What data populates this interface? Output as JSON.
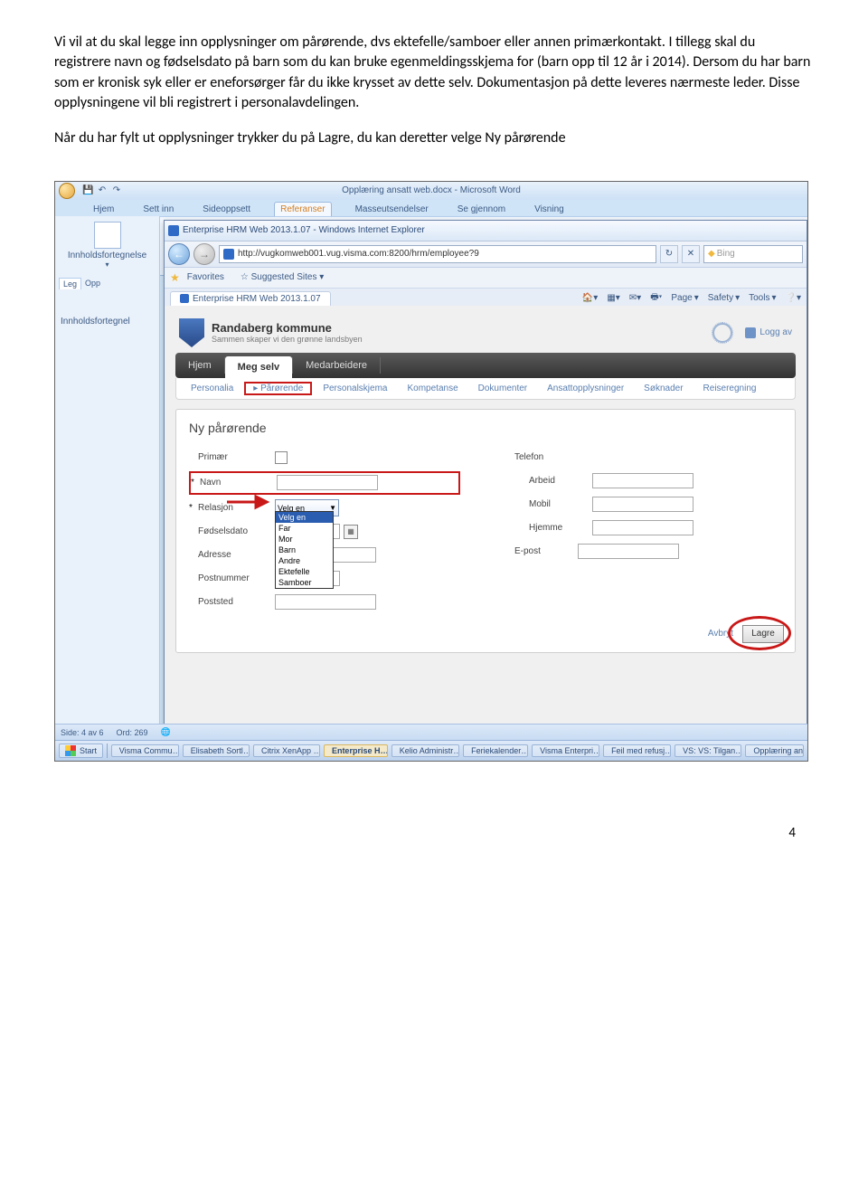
{
  "doc": {
    "p1": "Vi vil at du skal legge inn opplysninger om pårørende, dvs ektefelle/samboer eller annen primærkontakt. I tillegg skal du registrere navn og fødselsdato på barn som du kan bruke egenmeldingsskjema for (barn opp til 12 år i 2014). Dersom du har barn som er kronisk syk eller er eneforsørger får du ikke krysset av dette selv. Dokumentasjon på dette leveres nærmeste leder. Disse opplysningene vil bli registrert i personalavdelingen.",
    "p2": "Når du har fylt ut opplysninger trykker du på Lagre, du kan deretter velge Ny pårørende"
  },
  "word": {
    "title": "Opplæring ansatt web.docx - Microsoft Word",
    "tabs": [
      "Hjem",
      "Sett inn",
      "Sideoppsett",
      "Referanser",
      "Masseutsendelser",
      "Se gjennom",
      "Visning"
    ],
    "active_tab_idx": 3,
    "left_tabs": [
      "Leg",
      "Opp"
    ],
    "toc_label": "Innholdsfortegnelse",
    "toc_btn": "Innholdsfortegnel",
    "status_side": "Side: 4 av 6",
    "status_ord": "Ord: 269"
  },
  "ie": {
    "title": "Enterprise HRM Web 2013.1.07 - Windows Internet Explorer",
    "url": "http://vugkomweb001.vug.visma.com:8200/hrm/employee?9",
    "search_placeholder": "Bing",
    "fav_label": "Favorites",
    "suggested": "Suggested Sites",
    "tab_title": "Enterprise HRM Web 2013.1.07",
    "tools": [
      "Page",
      "Safety",
      "Tools"
    ]
  },
  "hrm": {
    "brand": "Randaberg kommune",
    "slogan": "Sammen skaper vi den grønne landsbyen",
    "logoff": "Logg av",
    "nav": [
      "Hjem",
      "Meg selv",
      "Medarbeidere"
    ],
    "nav_active_idx": 1,
    "subnav": [
      "Personalia",
      "Pårørende",
      "Personalskjema",
      "Kompetanse",
      "Dokumenter",
      "Ansattopplysninger",
      "Søknader",
      "Reiseregning"
    ],
    "subnav_hl_idx": 1,
    "form": {
      "title": "Ny pårørende",
      "left_labels": [
        "Primær",
        "Navn",
        "Relasjon",
        "Fødselsdato",
        "Adresse",
        "Postnummer",
        "Poststed"
      ],
      "right_labels": [
        "Telefon",
        "Arbeid",
        "Mobil",
        "Hjemme",
        "E-post"
      ],
      "select_value": "Velg en",
      "select_options": [
        "Velg en",
        "Far",
        "Mor",
        "Barn",
        "Andre",
        "Ektefelle",
        "Samboer"
      ],
      "avbryt": "Avbryt",
      "lagre": "Lagre"
    }
  },
  "taskbar": {
    "start": "Start",
    "items": [
      "Visma Commu…",
      "Elisabeth Sortl…",
      "Citrix XenApp …",
      "Enterprise H…",
      "Kelio Administr…",
      "Feriekalender…",
      "Visma Enterpri…",
      "Feil med refusj…",
      "VS: VS: Tilgan…",
      "Opplæring an"
    ],
    "active_idx": 3
  },
  "page_number": "4"
}
